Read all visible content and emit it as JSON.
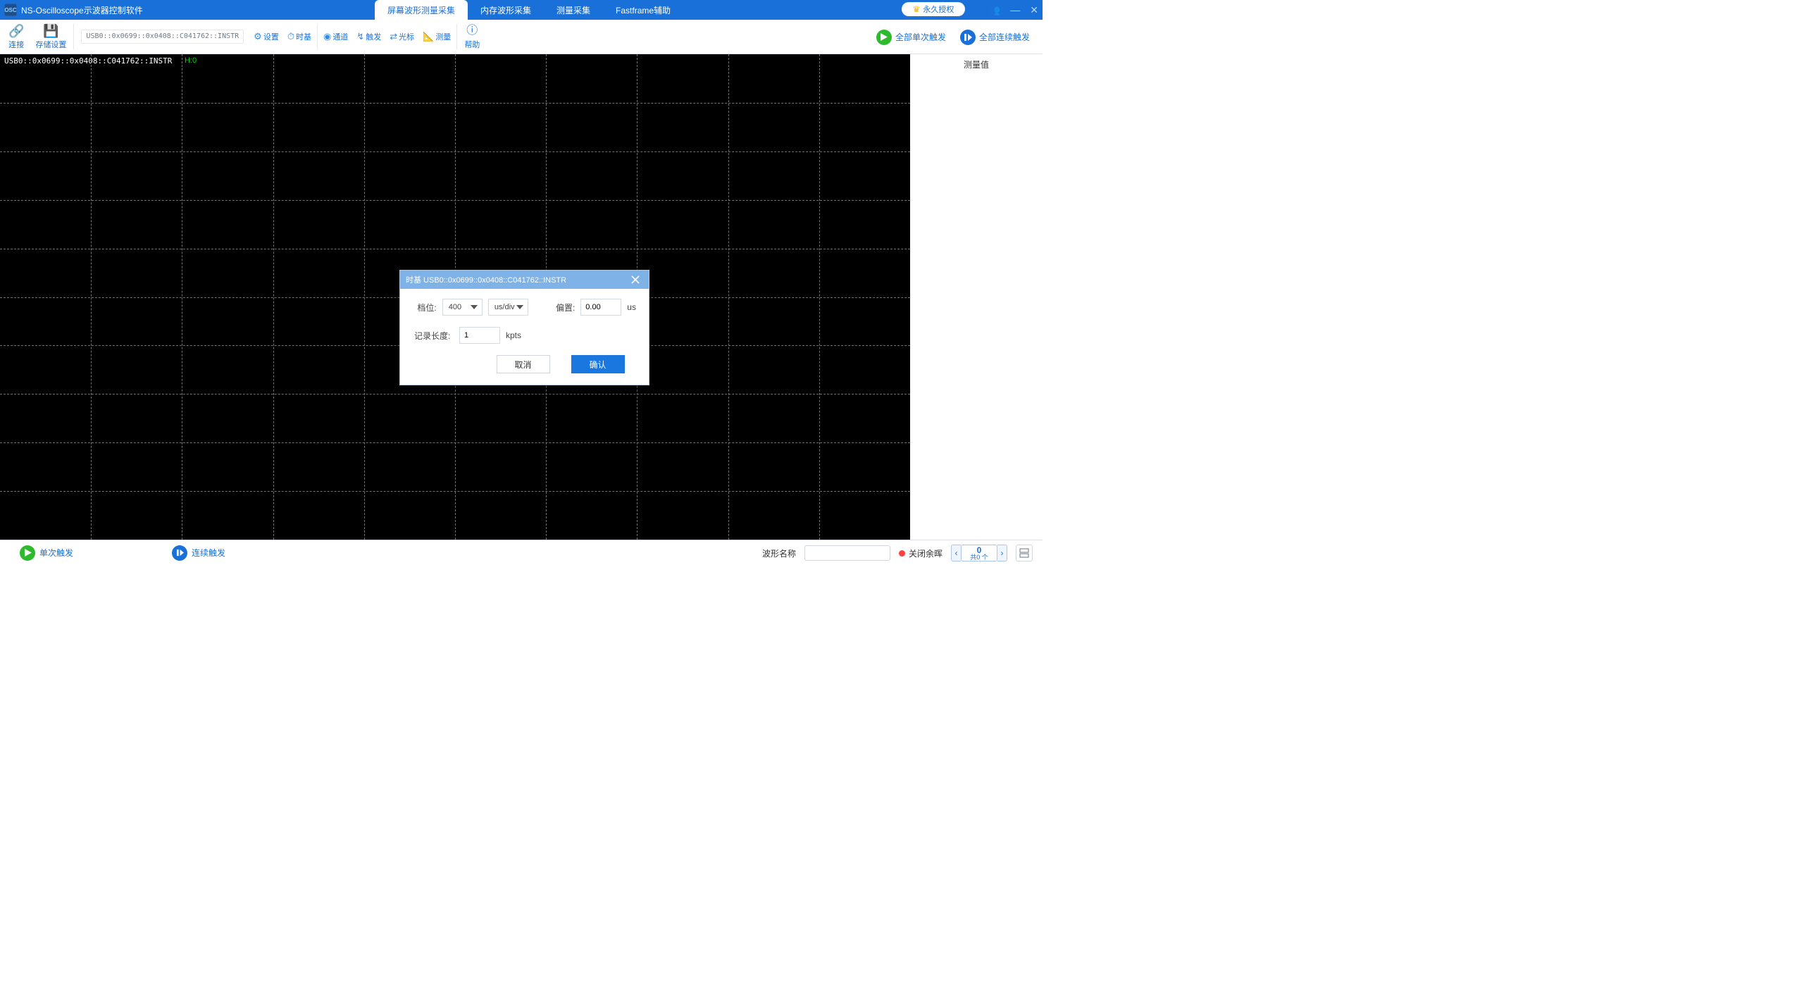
{
  "app": {
    "title": "NS-Oscilloscope示波器控制软件"
  },
  "license": {
    "label": "永久授权"
  },
  "tabs": {
    "t0": "屏幕波形测量采集",
    "t1": "内存波形采集",
    "t2": "测量采集",
    "t3": "Fastframe辅助"
  },
  "toolbar": {
    "connect": "连接",
    "storage": "存储设置",
    "instr_path": "USB0::0x0699::0x0408::C041762::INSTR",
    "settings": "设置",
    "timebase": "时基",
    "channel": "通道",
    "trigger": "触发",
    "cursor": "光标",
    "measure": "测量",
    "help": "帮助",
    "run_all_single": "全部单次触发",
    "run_all_cont": "全部连续触发"
  },
  "scope": {
    "instr_label": "USB0::0x0699::0x0408::C041762::INSTR",
    "h_label": "H:0"
  },
  "rightpane": {
    "title": "测量值"
  },
  "dialog": {
    "title": "时基  USB0::0x0699::0x0408::C041762::INSTR",
    "gear_label": "档位:",
    "gear_value": "400",
    "gear_unit": "us/div",
    "offset_label": "偏置:",
    "offset_value": "0.00",
    "offset_unit": "us",
    "reclen_label": "记录长度:",
    "reclen_value": "1",
    "reclen_unit": "kpts",
    "cancel": "取消",
    "ok": "确认"
  },
  "bottom": {
    "single": "单次触发",
    "cont": "连续触发",
    "wf_name_label": "波形名称",
    "afterglow": "关闭余晖",
    "counter_val": "0",
    "counter_sub": "共0 个"
  }
}
